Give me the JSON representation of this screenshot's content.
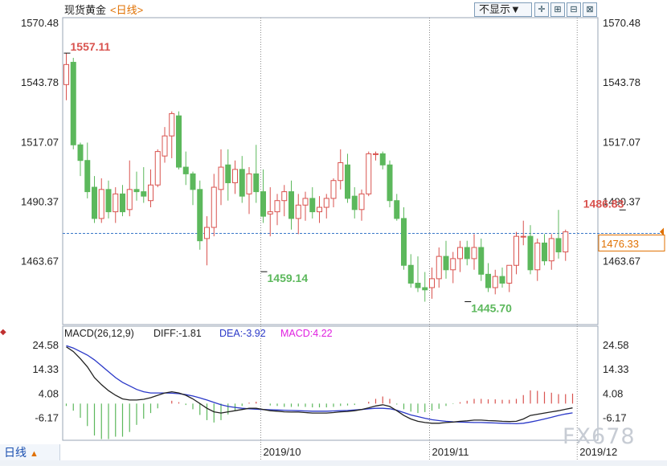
{
  "title": {
    "name": "现货黄金",
    "period": "<日线>"
  },
  "toolbar": {
    "hide_label": "不显示▼",
    "icons": [
      "crosshair-icon",
      "zoom-in-icon",
      "zoom-out-icon",
      "zoom-reset-icon"
    ]
  },
  "period_button": {
    "label": "日线",
    "arrow": "▲"
  },
  "watermark": "FX678",
  "colors": {
    "up": "#d9534f",
    "down": "#5cb85c",
    "price_line": "#3a78c8",
    "diff": "#222222",
    "dea": "#2a38c8",
    "macd_label": "#e020e0"
  },
  "chart_data": [
    {
      "type": "candlestick",
      "title": "现货黄金",
      "y_ticks": [
        "1570.48",
        "1543.78",
        "1517.07",
        "1490.37",
        "1463.67"
      ],
      "ylim": [
        1440,
        1575
      ],
      "x_labels": [
        {
          "index": 28,
          "label": "2019/10"
        },
        {
          "index": 52,
          "label": "2019/11"
        },
        {
          "index": 73,
          "label": "2019/12"
        }
      ],
      "current_price": "1476.33",
      "annotations": [
        {
          "index": 0,
          "label": "1557.11",
          "value": 1557.11,
          "kind": "high"
        },
        {
          "index": 28,
          "label": "1459.14",
          "value": 1459.14,
          "kind": "low"
        },
        {
          "index": 57,
          "label": "1445.70",
          "value": 1445.7,
          "kind": "low"
        },
        {
          "index": 79,
          "label": "1486.83",
          "value": 1486.83,
          "kind": "high"
        }
      ],
      "ohlc": [
        [
          1543,
          1557.11,
          1536,
          1552
        ],
        [
          1553,
          1555,
          1514,
          1516
        ],
        [
          1516,
          1517,
          1502,
          1509
        ],
        [
          1509,
          1517,
          1492,
          1495
        ],
        [
          1497,
          1502,
          1481,
          1483
        ],
        [
          1483,
          1501,
          1481,
          1496
        ],
        [
          1496,
          1500,
          1483,
          1486
        ],
        [
          1486,
          1497,
          1481,
          1494
        ],
        [
          1494,
          1498,
          1484,
          1486
        ],
        [
          1487,
          1509,
          1484,
          1496
        ],
        [
          1496,
          1504,
          1491,
          1495
        ],
        [
          1495,
          1506,
          1490,
          1493
        ],
        [
          1491,
          1505,
          1488,
          1498
        ],
        [
          1498,
          1514,
          1497,
          1513
        ],
        [
          1511,
          1524,
          1508,
          1520
        ],
        [
          1520,
          1531,
          1510,
          1530
        ],
        [
          1529,
          1531,
          1505,
          1506
        ],
        [
          1506,
          1513,
          1498,
          1503
        ],
        [
          1503,
          1504,
          1489,
          1496
        ],
        [
          1496,
          1500,
          1469,
          1473
        ],
        [
          1474,
          1484,
          1462,
          1479
        ],
        [
          1479,
          1503,
          1475,
          1497
        ],
        [
          1496,
          1514,
          1489,
          1506
        ],
        [
          1507,
          1514,
          1491,
          1499
        ],
        [
          1499,
          1509,
          1494,
          1505
        ],
        [
          1505,
          1511,
          1490,
          1493
        ],
        [
          1494,
          1506,
          1485,
          1503
        ],
        [
          1503,
          1516,
          1490,
          1495
        ],
        [
          1495,
          1505,
          1481,
          1484
        ],
        [
          1485,
          1497,
          1475,
          1486
        ],
        [
          1486,
          1494,
          1480,
          1491
        ],
        [
          1491,
          1498,
          1484,
          1495
        ],
        [
          1495,
          1500,
          1478,
          1483
        ],
        [
          1483,
          1494,
          1476,
          1489
        ],
        [
          1489,
          1495,
          1482,
          1492
        ],
        [
          1492,
          1497,
          1483,
          1486
        ],
        [
          1486,
          1493,
          1481,
          1488
        ],
        [
          1488,
          1494,
          1483,
          1492
        ],
        [
          1492,
          1501,
          1488,
          1500
        ],
        [
          1500,
          1514,
          1496,
          1508
        ],
        [
          1507,
          1512,
          1490,
          1492
        ],
        [
          1493,
          1497,
          1483,
          1487
        ],
        [
          1487,
          1496,
          1482,
          1494
        ],
        [
          1494,
          1513,
          1493,
          1512
        ],
        [
          1512,
          1513,
          1509,
          1512
        ],
        [
          1512,
          1513,
          1505,
          1507
        ],
        [
          1507,
          1509,
          1488,
          1491
        ],
        [
          1491,
          1494,
          1482,
          1483
        ],
        [
          1483,
          1488,
          1460,
          1462
        ],
        [
          1462,
          1467,
          1452,
          1454
        ],
        [
          1454,
          1466,
          1450,
          1452
        ],
        [
          1452,
          1459,
          1445.7,
          1451
        ],
        [
          1452,
          1461,
          1447,
          1456
        ],
        [
          1456,
          1470,
          1452,
          1466
        ],
        [
          1466,
          1473,
          1456,
          1460
        ],
        [
          1460,
          1468,
          1454,
          1465
        ],
        [
          1465,
          1473,
          1459,
          1470
        ],
        [
          1470,
          1473,
          1462,
          1465
        ],
        [
          1465,
          1476,
          1460,
          1470
        ],
        [
          1470,
          1474,
          1455,
          1458
        ],
        [
          1458,
          1463,
          1450,
          1452
        ],
        [
          1452,
          1460,
          1449,
          1457
        ],
        [
          1457,
          1461,
          1452,
          1454
        ],
        [
          1454,
          1462,
          1450,
          1462
        ],
        [
          1462,
          1477,
          1458,
          1475
        ],
        [
          1475,
          1482,
          1471,
          1475
        ],
        [
          1475,
          1480,
          1458,
          1460
        ],
        [
          1460,
          1474,
          1455,
          1472
        ],
        [
          1472,
          1476,
          1462,
          1464
        ],
        [
          1464,
          1476,
          1460,
          1474
        ],
        [
          1474,
          1486.83,
          1465,
          1468
        ],
        [
          1468,
          1478,
          1464,
          1477
        ]
      ]
    },
    {
      "type": "macd",
      "title": "MACD(26,12,9)",
      "params": "MACD(26,12,9)",
      "readout": {
        "diff": "DIFF:-1.81",
        "dea": "DEA:-3.92",
        "macd": "MACD:4.22"
      },
      "y_ticks": [
        "24.58",
        "14.33",
        "4.08",
        "-6.17"
      ],
      "ylim": [
        -12,
        28
      ],
      "diff": [
        24,
        22,
        19,
        15.5,
        11,
        8,
        5.5,
        3.5,
        2,
        1.5,
        1.5,
        1.8,
        2.5,
        3.5,
        4.5,
        5,
        4.5,
        3.5,
        2,
        0,
        -2,
        -3.5,
        -4,
        -3.5,
        -3,
        -2.5,
        -2,
        -2,
        -2.5,
        -3,
        -3.2,
        -3.5,
        -3.6,
        -3.6,
        -3.8,
        -4,
        -4,
        -4,
        -3.8,
        -3.5,
        -3.3,
        -3,
        -2.5,
        -1.8,
        -1,
        -0.5,
        -1.2,
        -3,
        -5,
        -6.5,
        -7.5,
        -8,
        -8.3,
        -8.3,
        -8,
        -7.8,
        -7.5,
        -7.3,
        -7,
        -7,
        -7.2,
        -7.3,
        -7.5,
        -7.6,
        -7.5,
        -6.5,
        -5,
        -4.5,
        -4,
        -3.5,
        -3,
        -2.4,
        -1.81
      ],
      "dea": [
        24.5,
        23.5,
        22,
        20.5,
        18.5,
        16,
        13.5,
        11,
        9,
        7.5,
        6,
        5,
        4.5,
        4.5,
        4.5,
        4.4,
        4.2,
        3.8,
        3.2,
        2.4,
        1.5,
        0.5,
        -0.5,
        -1.2,
        -1.6,
        -2,
        -2.2,
        -2.4,
        -2.5,
        -2.6,
        -2.7,
        -2.8,
        -2.9,
        -3,
        -3.1,
        -3.2,
        -3.2,
        -3.2,
        -3.1,
        -3,
        -2.9,
        -2.7,
        -2.5,
        -2.2,
        -2,
        -2,
        -2.2,
        -2.8,
        -3.8,
        -4.8,
        -5.5,
        -6.2,
        -6.8,
        -7.2,
        -7.5,
        -7.7,
        -7.8,
        -7.9,
        -8,
        -8,
        -8.1,
        -8.2,
        -8.3,
        -8.4,
        -8.5,
        -8.3,
        -7.8,
        -7.2,
        -6.5,
        -5.8,
        -5,
        -4.4,
        -3.92
      ],
      "macd": [
        -1,
        -3,
        -6,
        -9.5,
        -13.5,
        -15,
        -15,
        -14,
        -14,
        -12,
        -9,
        -6.4,
        -4,
        -2,
        0,
        1.2,
        0.6,
        -0.6,
        -2.4,
        -4.8,
        -7,
        -8,
        -7,
        -4.6,
        -2.8,
        -1,
        0.4,
        0.8,
        0,
        -0.8,
        -1,
        -1.4,
        -1.4,
        -1.2,
        -1.4,
        -1.6,
        -1.6,
        -1.6,
        -1.4,
        -1,
        -0.8,
        -0.6,
        0,
        0.8,
        2,
        3,
        2,
        -0.4,
        -2.4,
        -3.4,
        -4,
        -3.6,
        -3,
        -2.2,
        -1,
        -0.2,
        0.6,
        1.2,
        2,
        2,
        1.8,
        1.8,
        1.6,
        1.6,
        2,
        3.6,
        5.6,
        5.4,
        5,
        4.6,
        4,
        4,
        4.22
      ]
    }
  ]
}
